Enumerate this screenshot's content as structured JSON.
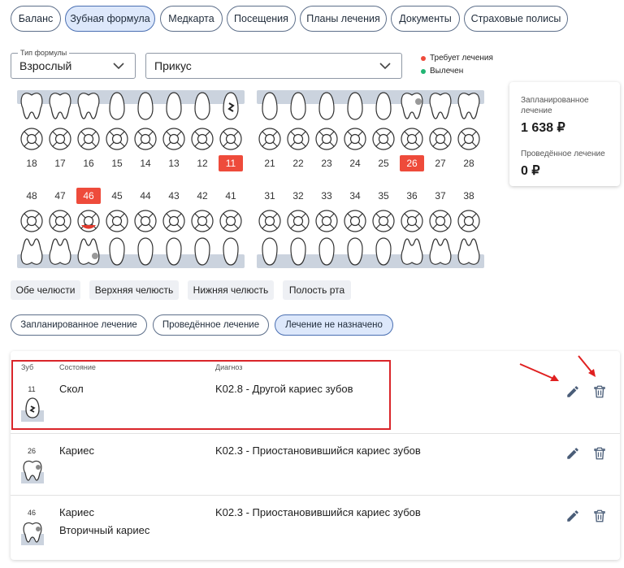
{
  "tabs": [
    {
      "label": "Баланс"
    },
    {
      "label": "Зубная формула",
      "active": true
    },
    {
      "label": "Медкарта"
    },
    {
      "label": "Посещения"
    },
    {
      "label": "Планы лечения"
    },
    {
      "label": "Документы"
    },
    {
      "label": "Страховые полисы"
    }
  ],
  "formula_type": {
    "label": "Тип формулы",
    "value": "Взрослый"
  },
  "bite": {
    "value": "Прикус"
  },
  "legend": [
    {
      "label": "Требует лечения",
      "color": "#ee4b3b"
    },
    {
      "label": "Вылечен",
      "color": "#22b573"
    }
  ],
  "summary": {
    "planned_label": "Запланированное лечение",
    "planned_value": "1 638 ₽",
    "done_label": "Проведённое лечение",
    "done_value": "0 ₽"
  },
  "upper_teeth": [
    {
      "num": "18",
      "type": "molar"
    },
    {
      "num": "17",
      "type": "molar"
    },
    {
      "num": "16",
      "type": "molar"
    },
    {
      "num": "15",
      "type": "single"
    },
    {
      "num": "14",
      "type": "single"
    },
    {
      "num": "13",
      "type": "single"
    },
    {
      "num": "12",
      "type": "single"
    },
    {
      "num": "11",
      "type": "chip",
      "red": true
    },
    {
      "num": "21",
      "type": "single"
    },
    {
      "num": "22",
      "type": "single"
    },
    {
      "num": "23",
      "type": "single"
    },
    {
      "num": "24",
      "type": "single"
    },
    {
      "num": "25",
      "type": "single"
    },
    {
      "num": "26",
      "type": "molar-caries",
      "red": true
    },
    {
      "num": "27",
      "type": "molar"
    },
    {
      "num": "28",
      "type": "molar"
    }
  ],
  "lower_teeth": [
    {
      "num": "48",
      "type": "molar"
    },
    {
      "num": "47",
      "type": "molar"
    },
    {
      "num": "46",
      "type": "molar-caries",
      "red": true
    },
    {
      "num": "45",
      "type": "single"
    },
    {
      "num": "44",
      "type": "single"
    },
    {
      "num": "43",
      "type": "single"
    },
    {
      "num": "42",
      "type": "single"
    },
    {
      "num": "41",
      "type": "single"
    },
    {
      "num": "31",
      "type": "single"
    },
    {
      "num": "32",
      "type": "single"
    },
    {
      "num": "33",
      "type": "single"
    },
    {
      "num": "34",
      "type": "single"
    },
    {
      "num": "35",
      "type": "single"
    },
    {
      "num": "36",
      "type": "molar"
    },
    {
      "num": "37",
      "type": "molar"
    },
    {
      "num": "38",
      "type": "molar"
    }
  ],
  "jaw_filters": [
    "Обе челюсти",
    "Верхняя челюсть",
    "Нижняя челюсть",
    "Полость рта"
  ],
  "plan_tabs": [
    {
      "label": "Запланированное лечение"
    },
    {
      "label": "Проведённое лечение"
    },
    {
      "label": "Лечение не назначено",
      "active": true
    }
  ],
  "table": {
    "headers": {
      "tooth": "Зуб",
      "state": "Состояние",
      "diagnosis": "Диагноз"
    },
    "rows": [
      {
        "tooth": "11",
        "state": "Скол",
        "state2": "",
        "diagnosis": "K02.8 - Другой кариес зубов"
      },
      {
        "tooth": "26",
        "state": "Кариес",
        "state2": "",
        "diagnosis": "K02.3 - Приостановившийся кариес зубов"
      },
      {
        "tooth": "46",
        "state": "Кариес",
        "state2": "Вторичный кариес",
        "diagnosis": "K02.3 - Приостановившийся кариес зубов"
      }
    ]
  }
}
